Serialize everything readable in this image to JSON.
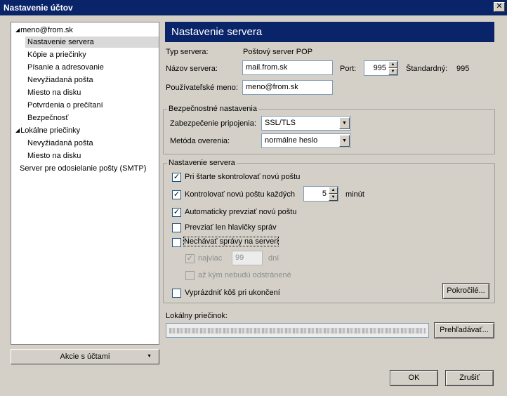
{
  "window": {
    "title": "Nastavenie účtov",
    "close_glyph": "✕"
  },
  "tree": {
    "items": [
      {
        "label": "meno@from.sk",
        "level": 0,
        "expanded": true
      },
      {
        "label": "Nastavenie servera",
        "level": 1,
        "selected": true
      },
      {
        "label": "Kópie a priečinky",
        "level": 1
      },
      {
        "label": "Písanie a adresovanie",
        "level": 1
      },
      {
        "label": "Nevyžiadaná pošta",
        "level": 1
      },
      {
        "label": "Miesto na disku",
        "level": 1
      },
      {
        "label": "Potvrdenia o prečítaní",
        "level": 1
      },
      {
        "label": "Bezpečnosť",
        "level": 1
      },
      {
        "label": "Lokálne priečinky",
        "level": 0,
        "expanded": true
      },
      {
        "label": "Nevyžiadaná pošta",
        "level": 1
      },
      {
        "label": "Miesto na disku",
        "level": 1
      },
      {
        "label": "Server pre odosielanie pošty (SMTP)",
        "level": 0
      }
    ],
    "account_actions_label": "Akcie s účtami"
  },
  "pane": {
    "header": "Nastavenie servera",
    "server_type_label": "Typ servera:",
    "server_type_value": "Poštový server POP",
    "server_name_label": "Názov servera:",
    "server_name_value": "mail.from.sk",
    "port_label": "Port:",
    "port_value": "995",
    "default_label": "Štandardný:",
    "default_value": "995",
    "username_label": "Používateľské meno:",
    "username_value": "meno@from.sk"
  },
  "security": {
    "legend": "Bezpečnostné nastavenia",
    "connection_label": "Zabezpečenie pripojenia:",
    "connection_value": "SSL/TLS",
    "auth_label": "Metóda overenia:",
    "auth_value": "normálne heslo"
  },
  "server_settings": {
    "legend": "Nastavenie servera",
    "check_on_start": {
      "label": "Pri štarte skontrolovať novú poštu",
      "checked": true
    },
    "check_every": {
      "label": "Kontrolovať novú poštu každých",
      "checked": true,
      "value": "5",
      "unit": "minút"
    },
    "auto_download": {
      "label": "Automaticky prevziať novú poštu",
      "checked": true
    },
    "headers_only": {
      "label": "Prevziať len hlavičky správ",
      "checked": false
    },
    "leave_on_server": {
      "label": "Nechávať správy na serveri",
      "checked": false
    },
    "at_most": {
      "label": "najviac",
      "checked": true,
      "value": "99",
      "unit": "dní"
    },
    "until_deleted": {
      "label": "až kým nebudú odstránené",
      "checked": false
    },
    "empty_trash": {
      "label": "Vyprázdniť kôš pri ukončení",
      "checked": false
    },
    "advanced_label": "Pokročilé..."
  },
  "local_folder": {
    "label": "Lokálny priečinok:",
    "browse_label": "Prehľadávať..."
  },
  "footer": {
    "ok_label": "OK",
    "cancel_label": "Zrušiť"
  },
  "glyphs": {
    "check": "✓",
    "tree_expanded": "◢",
    "dropdown": "▼",
    "spin_up": "▲",
    "spin_down": "▼"
  }
}
